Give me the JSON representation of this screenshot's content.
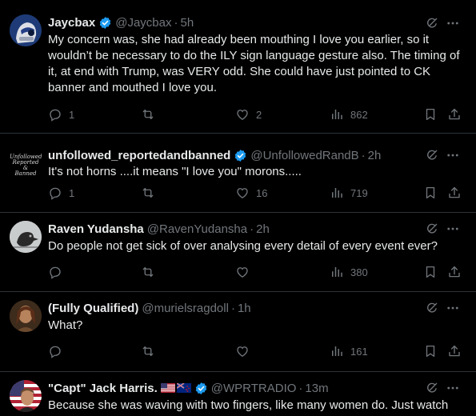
{
  "tweets": [
    {
      "name": "Jaycbax",
      "verified": true,
      "handle": "@Jaycbax",
      "sep": "·",
      "time": "5h",
      "text": "My concern was, she had already been mouthing I love you earlier, so it wouldn’t be necessary to do the ILY sign language gesture also. The timing of it, at end with Trump, was VERY odd. She could have just pointed to CK banner and mouthed I love you.",
      "replies": "1",
      "retweets": "",
      "likes": "2",
      "views": "862"
    },
    {
      "name": "unfollowed_reportedandbanned",
      "verified": true,
      "handle": "@UnfollowedRandB",
      "sep": "·",
      "time": "2h",
      "avatar_text": [
        "Unfollowed",
        "Reported &",
        "Banned"
      ],
      "text": "It's not horns ....it means \"I love you\" morons.....",
      "replies": "1",
      "retweets": "",
      "likes": "16",
      "views": "719"
    },
    {
      "name": "Raven Yudansha",
      "verified": false,
      "handle": "@RavenYudansha",
      "sep": "·",
      "time": "2h",
      "text": "Do people not get sick of over analysing every detail of every event ever?",
      "replies": "",
      "retweets": "",
      "likes": "",
      "views": "380"
    },
    {
      "name": "(Fully Qualified)",
      "verified": false,
      "handle": "@murielsragdoll",
      "sep": "·",
      "time": "1h",
      "text": "What?",
      "replies": "",
      "retweets": "",
      "likes": "",
      "views": "161"
    },
    {
      "name": "\"Capt\" Jack Harris.",
      "verified": true,
      "handle": "@WPRTRADIO",
      "sep": "·",
      "time": "13m",
      "flags": [
        "us-flag-icon",
        "nz-flag-icon"
      ],
      "text": "Because she was waving with two fingers, like many women do. Just watch"
    }
  ],
  "colors": {
    "background": "#000000",
    "text": "#e7e9ea",
    "muted": "#71767b",
    "verified": "#1d9bf0",
    "divider": "#2f3336"
  }
}
